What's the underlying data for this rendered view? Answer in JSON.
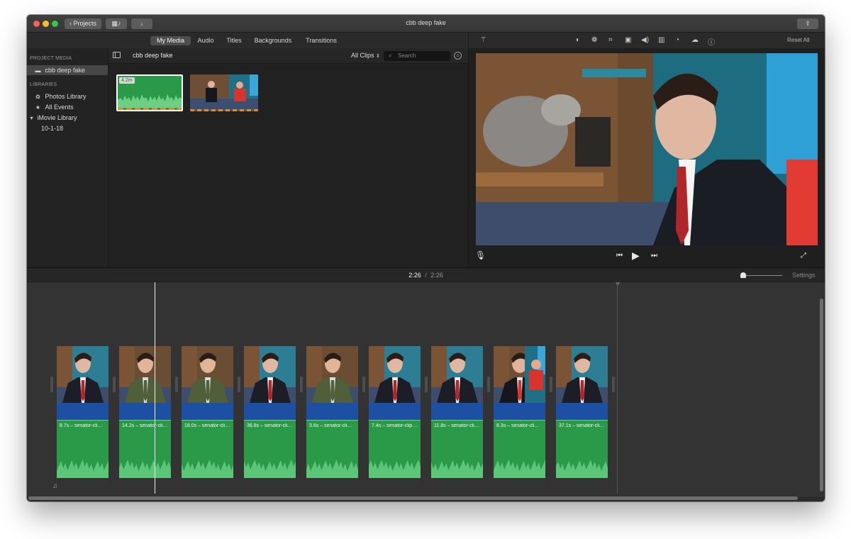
{
  "window": {
    "title": "cbb deep fake"
  },
  "toolbar": {
    "projects_label": "Projects"
  },
  "browser_tabs": [
    {
      "label": "My Media",
      "active": true
    },
    {
      "label": "Audio",
      "active": false
    },
    {
      "label": "Titles",
      "active": false
    },
    {
      "label": "Backgrounds",
      "active": false
    },
    {
      "label": "Transitions",
      "active": false
    }
  ],
  "sidebar": {
    "project_media_heading": "PROJECT MEDIA",
    "project_item": "cbb deep fake",
    "libraries_heading": "LIBRARIES",
    "libraries": [
      {
        "label": "Photos Library",
        "icon": "flower-icon"
      },
      {
        "label": "All Events",
        "icon": "star-icon"
      },
      {
        "label": "iMovie Library",
        "icon": "disclosure-triangle-icon"
      },
      {
        "label": "10-1-18",
        "icon": ""
      }
    ]
  },
  "browser": {
    "title": "cbb deep fake",
    "filter_label": "All Clips",
    "search_placeholder": "Search",
    "clips": [
      {
        "duration_badge": "4.2m",
        "kind": "audio",
        "selected": true
      },
      {
        "duration_badge": "",
        "kind": "video",
        "selected": false
      }
    ]
  },
  "viewer": {
    "reset_all": "Reset All",
    "tool_icons": [
      "color-balance-icon",
      "color-correction-icon",
      "crop-icon",
      "stabilization-icon",
      "volume-icon",
      "noise-reduction-icon",
      "speed-icon",
      "clip-filter-icon",
      "info-icon"
    ]
  },
  "timeline": {
    "current_time": "2:26",
    "separator": "/",
    "total_time": "2:26",
    "settings_label": "Settings",
    "clips": [
      {
        "label": "8.7s – senator-cli…",
        "subject": "senator"
      },
      {
        "label": "14.2s – senator-cli…",
        "subject": "host"
      },
      {
        "label": "18.0s – senator-cli…",
        "subject": "host"
      },
      {
        "label": "36.8s – senator-cli…",
        "subject": "senator"
      },
      {
        "label": "3.6s – senator-cli…",
        "subject": "host"
      },
      {
        "label": "7.4s – senator-clip…",
        "subject": "senator"
      },
      {
        "label": "11.8s – senator-cli…",
        "subject": "senator"
      },
      {
        "label": "8.3s – senator-cli…",
        "subject": "wide"
      },
      {
        "label": "37.1s – senator-cli…",
        "subject": "senator"
      }
    ]
  },
  "colors": {
    "audio_green": "#2a9a48",
    "blue_track": "#1d50a3",
    "selected_border": "#ffffff",
    "playhead": "#f2f2f2"
  }
}
